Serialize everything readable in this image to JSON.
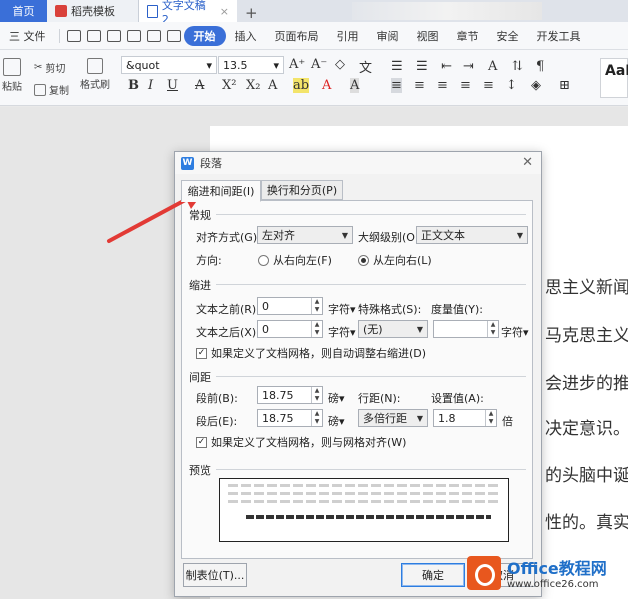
{
  "tabs": [
    {
      "label": "首页"
    },
    {
      "label": "稻壳模板"
    },
    {
      "label": "文字文稿2"
    }
  ],
  "tab_add": "+",
  "menu": {
    "file": "三 文件",
    "items": [
      "开始",
      "插入",
      "页面布局",
      "引用",
      "审阅",
      "视图",
      "章节",
      "安全",
      "开发工具"
    ],
    "active": "开始"
  },
  "ribbon": {
    "paste": "粘贴",
    "cut": "剪切",
    "copy": "复制",
    "format_painter": "格式刷",
    "font_name": "&quot",
    "font_size": "13.5",
    "style_preview": "AaB"
  },
  "document": {
    "lines": [
      "思主义新闻",
      "马克思主义",
      "会进步的推",
      "决定意识。",
      "的头脑中诞",
      "性的。真实"
    ]
  },
  "dialog": {
    "title": "段落",
    "tabs": [
      "缩进和间距(I)",
      "换行和分页(P)"
    ],
    "general": {
      "section": "常规",
      "alignment_label": "对齐方式(G):",
      "alignment_value": "左对齐",
      "outline_label": "大纲级别(O):",
      "outline_value": "正文文本",
      "direction_label": "方向:",
      "rtl": "从右向左(F)",
      "ltr": "从左向右(L)"
    },
    "indent": {
      "section": "缩进",
      "before_label": "文本之前(R):",
      "before_value": "0",
      "after_label": "文本之后(X):",
      "after_value": "0",
      "unit": "字符",
      "special_label": "特殊格式(S):",
      "special_value": "(无)",
      "measure_label": "度量值(Y):",
      "measure_value": "",
      "grid_check": "如果定义了文档网格，则自动调整右缩进(D)"
    },
    "spacing": {
      "section": "间距",
      "before_label": "段前(B):",
      "before_value": "18.75",
      "after_label": "段后(E):",
      "after_value": "18.75",
      "unit": "磅",
      "line_label": "行距(N):",
      "line_value": "多倍行距",
      "setting_label": "设置值(A):",
      "setting_value": "1.8",
      "setting_unit": "倍",
      "grid_check": "如果定义了文档网格，则与网格对齐(W)"
    },
    "preview_label": "预览",
    "buttons": {
      "tabs": "制表位(T)...",
      "ok": "确定",
      "cancel": "取消"
    }
  },
  "watermark": {
    "brand": "Office教程网",
    "url": "www.office26.com"
  },
  "colors": {
    "accent": "#3a6fd8",
    "arrow": "#e23a35",
    "watermark_orange": "#e8571e"
  }
}
